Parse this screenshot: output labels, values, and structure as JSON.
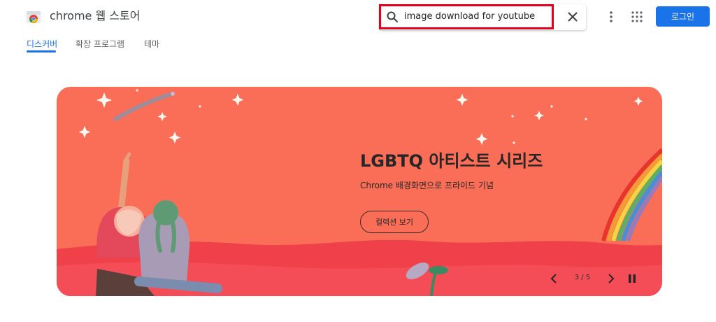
{
  "header": {
    "app_title": "chrome 웹 스토어",
    "search_value": "image download for youtube",
    "login_label": "로그인",
    "icons": [
      "chrome-logo-icon",
      "search-icon",
      "close-icon",
      "more-vert-icon",
      "apps-grid-icon"
    ]
  },
  "tabs": [
    {
      "label": "디스커버",
      "active": true
    },
    {
      "label": "확장 프로그램",
      "active": false
    },
    {
      "label": "테마",
      "active": false
    }
  ],
  "banner": {
    "title": "LGBTQ 아티스트 시리즈",
    "subtitle": "Chrome 배경화면으로 프라이드 기념",
    "button_label": "컬렉션 보기",
    "page_indicator": "3 / 5",
    "current_slide": 3,
    "total_slides": 5,
    "colors": {
      "background": "#fa6e58",
      "accent_blue": "#1a73e8",
      "search_highlight": "#e4001b"
    }
  }
}
